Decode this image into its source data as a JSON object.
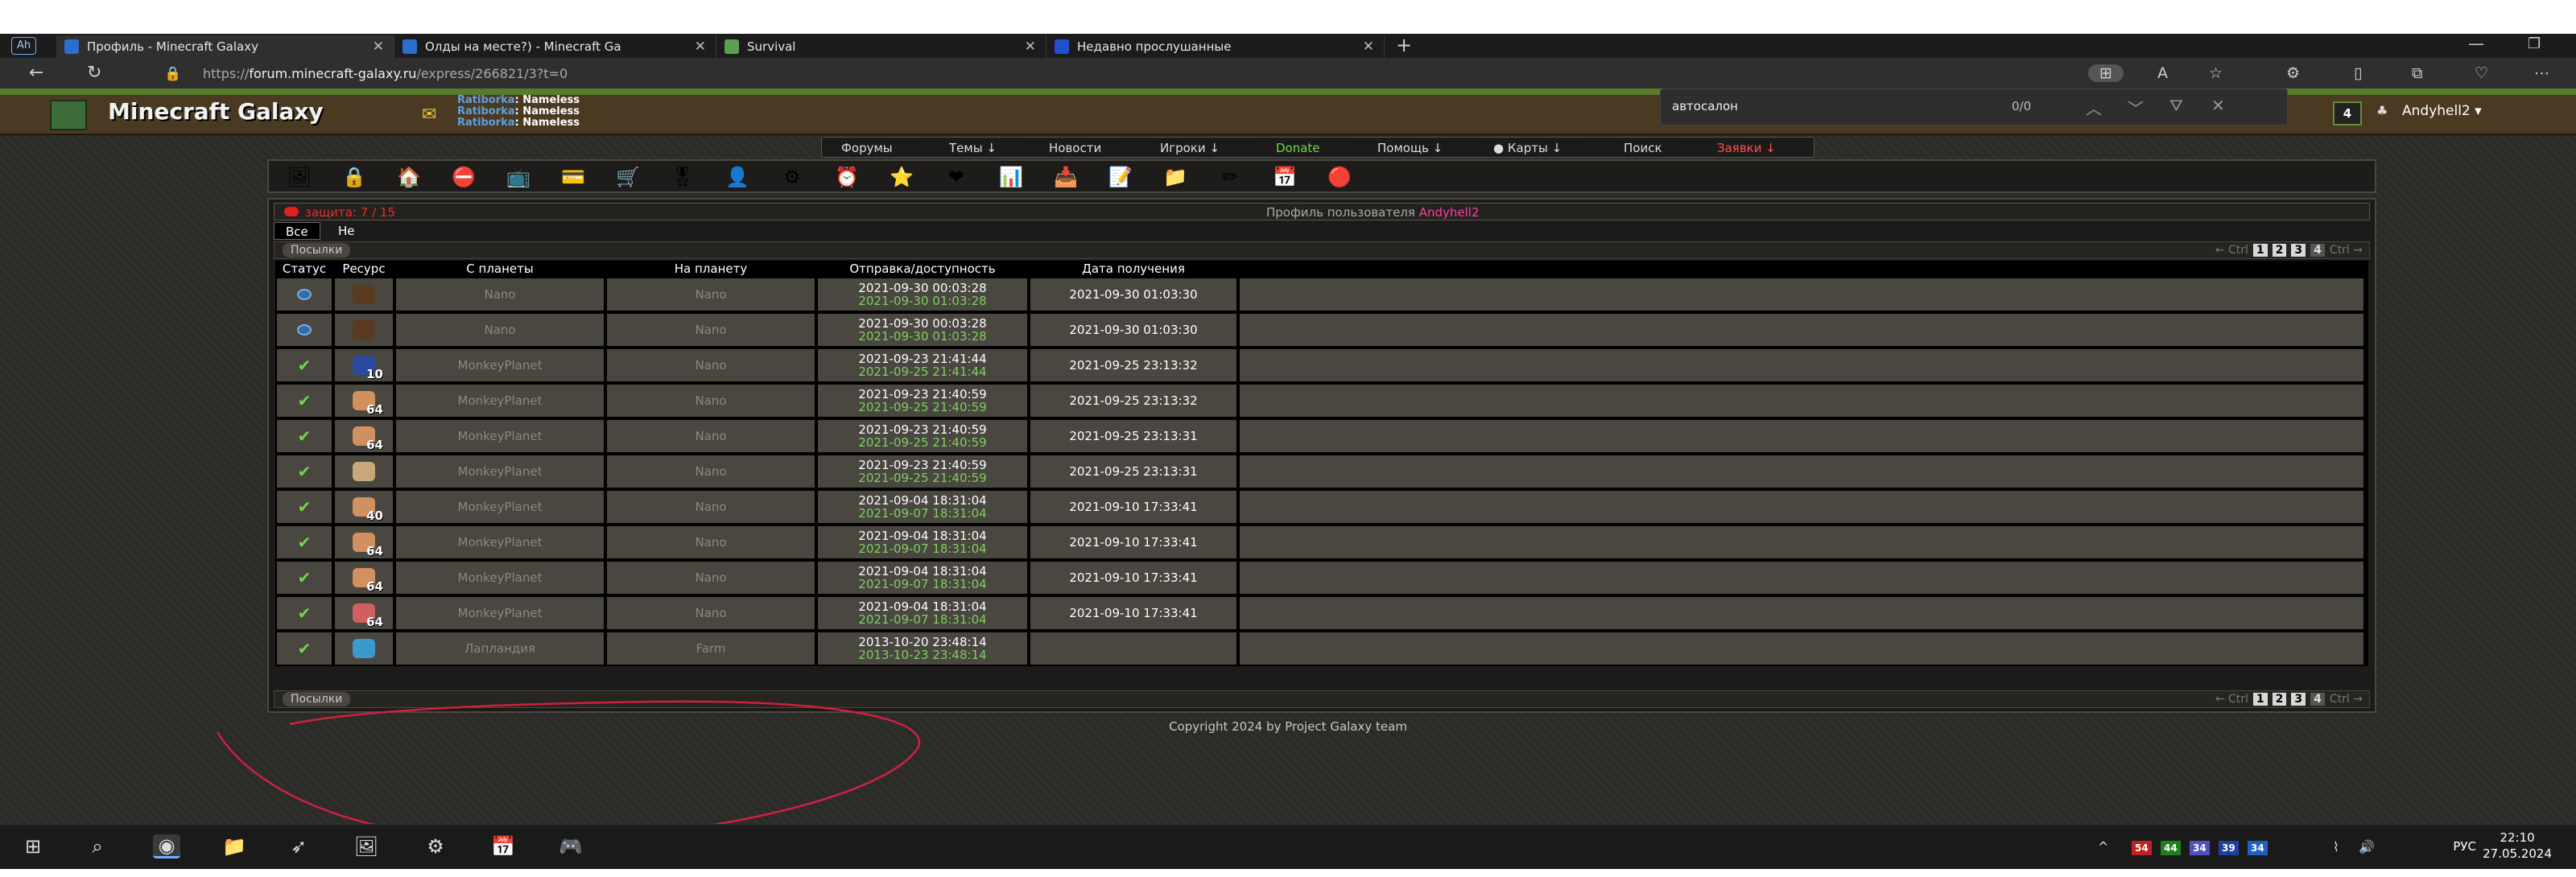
{
  "browser": {
    "tabs": [
      {
        "label": "Профиль - Minecraft Galaxy",
        "color": "#2a6fd0",
        "active": true
      },
      {
        "label": "Олды на месте?) - Minecraft Ga",
        "color": "#2a6fd0",
        "active": false
      },
      {
        "label": "Survival",
        "color": "#5aa050",
        "active": false
      },
      {
        "label": "Недавно прослушанные",
        "color": "#2050d0",
        "active": false
      }
    ],
    "url_prefix": "https://",
    "url_host": "forum.minecraft-galaxy.ru",
    "url_path": "/express/266821/3?t=0",
    "profile_badge": "Ah",
    "icons": [
      "back-icon",
      "refresh-icon",
      "lock-icon",
      "minimize-icon",
      "restore-icon"
    ]
  },
  "site": {
    "title": "Minecraft Galaxy",
    "nick_lines": [
      {
        "name": "Ratiborka",
        "value": ": Nameless"
      },
      {
        "name": "Ratiborka",
        "value": ": Nameless"
      },
      {
        "name": "Ratiborka",
        "value": ": Nameless"
      }
    ],
    "message_count": "4",
    "username": "Andyhell2 ▾"
  },
  "findbar": {
    "query": "автосалон",
    "count": "0/0"
  },
  "menu": [
    {
      "label": "Форумы",
      "color": "#dddddd"
    },
    {
      "label": "Темы ↓",
      "color": "#dddddd"
    },
    {
      "label": "Новости",
      "color": "#dddddd"
    },
    {
      "label": "Игроки ↓",
      "color": "#dddddd"
    },
    {
      "label": "Donate",
      "color": "#6fd84a"
    },
    {
      "label": "Помощь ↓",
      "color": "#dddddd"
    },
    {
      "label": "● Карты ↓",
      "color": "#dddddd"
    },
    {
      "label": "Поиск",
      "color": "#dddddd"
    },
    {
      "label": "Заявки ↓",
      "color": "#ff5050"
    }
  ],
  "toolbar_icons": [
    {
      "name": "picture-icon",
      "glyph": "🖼"
    },
    {
      "name": "lock-icon",
      "glyph": "🔒"
    },
    {
      "name": "home-icon",
      "glyph": "🏠"
    },
    {
      "name": "forbidden-icon",
      "glyph": "⛔"
    },
    {
      "name": "screen-icon",
      "glyph": "📺"
    },
    {
      "name": "card-icon",
      "glyph": "💳"
    },
    {
      "name": "cart-icon",
      "glyph": "🛒"
    },
    {
      "name": "medal-icon",
      "glyph": "🎖"
    },
    {
      "name": "user-icon",
      "glyph": "👤"
    },
    {
      "name": "gear-icon",
      "glyph": "⚙"
    },
    {
      "name": "clock-icon",
      "glyph": "⏰"
    },
    {
      "name": "star-icon",
      "glyph": "⭐"
    },
    {
      "name": "heart-icon",
      "glyph": "❤"
    },
    {
      "name": "chart-icon",
      "glyph": "📊"
    },
    {
      "name": "inbox-icon",
      "glyph": "📥"
    },
    {
      "name": "notes-icon",
      "glyph": "📝"
    },
    {
      "name": "folder-icon",
      "glyph": "📁"
    },
    {
      "name": "edit-icon",
      "glyph": "✏"
    },
    {
      "name": "calendar-icon",
      "glyph": "📅"
    },
    {
      "name": "red-dot-icon",
      "glyph": "🔴"
    }
  ],
  "panel": {
    "protection": "защита: 7 / 15",
    "profile_prefix": "Профиль пользователя ",
    "profile_user": "Andyhell2",
    "filters": [
      "Все",
      "Не принятые"
    ],
    "section_label": "Посылки",
    "pager": {
      "prev": "← Ctrl",
      "pages": [
        "1",
        "2",
        "3",
        "4"
      ],
      "current": "4",
      "next": "Ctrl →"
    }
  },
  "table": {
    "headers": [
      "Статус",
      "Ресурс",
      "С планеты",
      "На планету",
      "Отправка/доступность",
      "Дата получения"
    ],
    "rows": [
      {
        "status": "wait",
        "res_color": "#5a3a20",
        "qty": "",
        "from": "Nano",
        "to": "Nano",
        "sent": "2021-09-30 00:03:28",
        "avail": "2021-09-30 01:03:28",
        "received": "2021-09-30 01:03:30"
      },
      {
        "status": "wait",
        "res_color": "#5a3a20",
        "qty": "",
        "from": "Nano",
        "to": "Nano",
        "sent": "2021-09-30 00:03:28",
        "avail": "2021-09-30 01:03:28",
        "received": "2021-09-30 01:03:30"
      },
      {
        "status": "ok",
        "res_color": "#2a4aa0",
        "qty": "10",
        "from": "MonkeyPlanet",
        "to": "Nano",
        "sent": "2021-09-23 21:41:44",
        "avail": "2021-09-25 21:41:44",
        "received": "2021-09-25 23:13:32"
      },
      {
        "status": "ok",
        "res_color": "#d09060",
        "qty": "64",
        "from": "MonkeyPlanet",
        "to": "Nano",
        "sent": "2021-09-23 21:40:59",
        "avail": "2021-09-25 21:40:59",
        "received": "2021-09-25 23:13:32"
      },
      {
        "status": "ok",
        "res_color": "#d09060",
        "qty": "64",
        "from": "MonkeyPlanet",
        "to": "Nano",
        "sent": "2021-09-23 21:40:59",
        "avail": "2021-09-25 21:40:59",
        "received": "2021-09-25 23:13:31"
      },
      {
        "status": "ok",
        "res_color": "#c8a878",
        "qty": "",
        "from": "MonkeyPlanet",
        "to": "Nano",
        "sent": "2021-09-23 21:40:59",
        "avail": "2021-09-25 21:40:59",
        "received": "2021-09-25 23:13:31"
      },
      {
        "status": "ok",
        "res_color": "#d09060",
        "qty": "40",
        "from": "MonkeyPlanet",
        "to": "Nano",
        "sent": "2021-09-04 18:31:04",
        "avail": "2021-09-07 18:31:04",
        "received": "2021-09-10 17:33:41"
      },
      {
        "status": "ok",
        "res_color": "#d09060",
        "qty": "64",
        "from": "MonkeyPlanet",
        "to": "Nano",
        "sent": "2021-09-04 18:31:04",
        "avail": "2021-09-07 18:31:04",
        "received": "2021-09-10 17:33:41"
      },
      {
        "status": "ok",
        "res_color": "#d09060",
        "qty": "64",
        "from": "MonkeyPlanet",
        "to": "Nano",
        "sent": "2021-09-04 18:31:04",
        "avail": "2021-09-07 18:31:04",
        "received": "2021-09-10 17:33:41"
      },
      {
        "status": "ok",
        "res_color": "#d06060",
        "qty": "64",
        "from": "MonkeyPlanet",
        "to": "Nano",
        "sent": "2021-09-04 18:31:04",
        "avail": "2021-09-07 18:31:04",
        "received": "2021-09-10 17:33:41"
      },
      {
        "status": "ok",
        "res_color": "#3a9ad0",
        "qty": "",
        "from": "Лапландия",
        "to": "Farm",
        "sent": "2013-10-20 23:48:14",
        "avail": "2013-10-23 23:48:14",
        "received": ""
      }
    ]
  },
  "footer": {
    "copyright": "Copyright 2024 by Project Galaxy team"
  },
  "taskbar": {
    "apps": [
      {
        "name": "windows-start-icon",
        "glyph": "⊞"
      },
      {
        "name": "search-icon",
        "glyph": "⌕"
      },
      {
        "name": "edge-browser-icon",
        "glyph": "◉"
      },
      {
        "name": "file-explorer-icon",
        "glyph": "📁"
      },
      {
        "name": "feather-app-icon",
        "glyph": "➶"
      },
      {
        "name": "image-app-icon",
        "glyph": "🖼"
      },
      {
        "name": "steam-icon",
        "glyph": "⚙"
      },
      {
        "name": "calendar-app-icon",
        "glyph": "📅"
      },
      {
        "name": "discord-icon",
        "glyph": "🎮"
      }
    ],
    "tray_badges": [
      {
        "text": "54",
        "color": "#c02020"
      },
      {
        "text": "44",
        "color": "#208020"
      },
      {
        "text": "34",
        "color": "#5050c0"
      },
      {
        "text": "39",
        "color": "#2040a0"
      },
      {
        "text": "34",
        "color": "#2060c0"
      }
    ],
    "lang": "РУС",
    "time": "22:10",
    "date": "27.05.2024"
  }
}
